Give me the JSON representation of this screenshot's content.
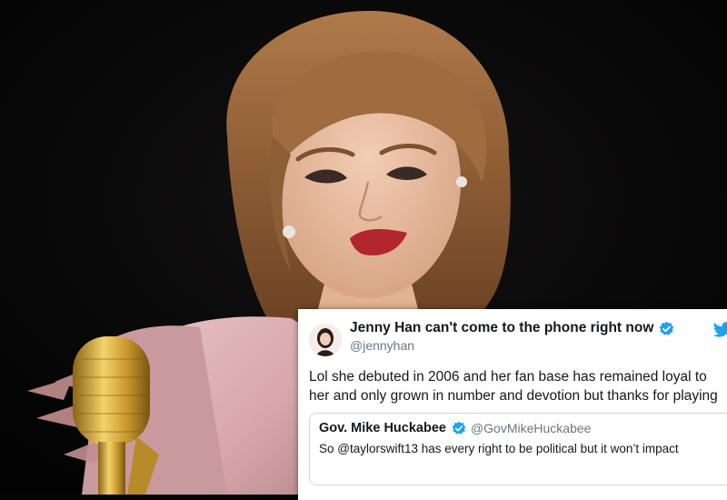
{
  "photo": {
    "description_icon": "portrait-photo"
  },
  "tweet": {
    "display_name": "Jenny Han can't come to the phone right now",
    "handle": "@jennyhan",
    "text": "Lol she debuted in 2006 and her fan base has remained loyal to her and only grown in number and devotion but thanks for playing",
    "verified_icon": "verified-badge-icon",
    "bird_icon": "twitter-bird-icon"
  },
  "quote": {
    "display_name": "Gov. Mike Huckabee",
    "handle": "@GovMikeHuckabee",
    "text": "So @taylorswift13 has every right to be political but it won’t impact"
  },
  "colors": {
    "verified": "#1da1f2",
    "name": "#14171a",
    "handle": "#657786",
    "border": "#ccd6dd"
  }
}
